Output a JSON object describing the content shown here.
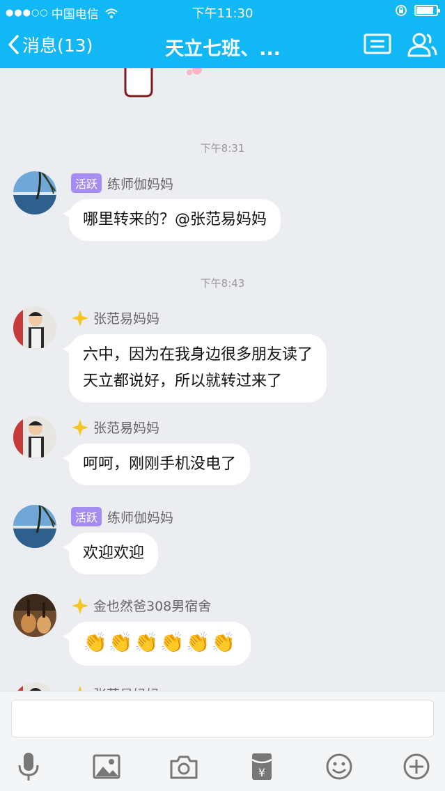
{
  "status_bar": {
    "signal_dots": "●●●○○",
    "carrier": "中国电信",
    "time": "下午11:30",
    "battery_level": 0.85
  },
  "nav": {
    "back_label": "消息(13)",
    "title": "天立七班、..."
  },
  "chat": {
    "timestamps": [
      "下午8:31",
      "下午8:43"
    ],
    "messages": [
      {
        "sender": "练师伽妈妈",
        "badge": "活跃",
        "text": "哪里转来的？@张范易妈妈"
      },
      {
        "sender": "张范易妈妈",
        "lines": [
          "六中，因为在我身边很多朋友读了",
          "天立都说好，所以就转过来了"
        ]
      },
      {
        "sender": "张范易妈妈",
        "text": "呵呵，刚刚手机没电了"
      },
      {
        "sender": "练师伽妈妈",
        "badge": "活跃",
        "text": "欢迎欢迎"
      },
      {
        "sender": "金也然爸308男宿舍",
        "emoji": [
          "👏",
          "👏",
          "👏",
          "👏",
          "👏",
          "👏"
        ]
      },
      {
        "sender": "张范易妈妈"
      }
    ]
  },
  "toolbar": {
    "icons": [
      "microphone-icon",
      "image-icon",
      "camera-icon",
      "red-packet-icon",
      "emoji-icon",
      "plus-icon"
    ]
  },
  "colors": {
    "nav_bg": "#12b7f5",
    "badge_bg": "#a58cf2",
    "chat_bg": "#ebedf1",
    "star": "#f7c622"
  }
}
